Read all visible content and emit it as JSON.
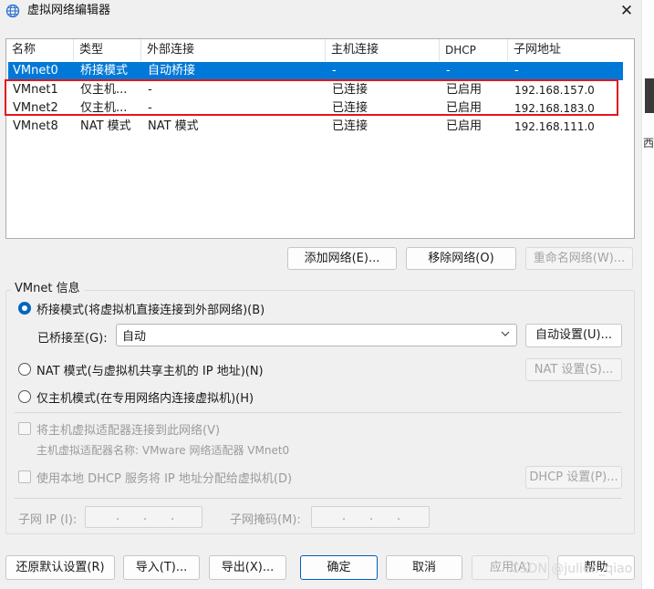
{
  "window": {
    "title": "虚拟网络编辑器",
    "close_glyph": "✕"
  },
  "table": {
    "columns": [
      "名称",
      "类型",
      "外部连接",
      "主机连接",
      "DHCP",
      "子网地址"
    ],
    "rows": [
      {
        "name": "VMnet0",
        "type": "桥接模式",
        "external": "自动桥接",
        "host": "-",
        "dhcp": "-",
        "subnet": "-",
        "selected": true
      },
      {
        "name": "VMnet1",
        "type": "仅主机...",
        "external": "-",
        "host": "已连接",
        "dhcp": "已启用",
        "subnet": "192.168.157.0",
        "selected": false
      },
      {
        "name": "VMnet2",
        "type": "仅主机...",
        "external": "-",
        "host": "已连接",
        "dhcp": "已启用",
        "subnet": "192.168.183.0",
        "selected": false
      },
      {
        "name": "VMnet8",
        "type": "NAT 模式",
        "external": "NAT 模式",
        "host": "已连接",
        "dhcp": "已启用",
        "subnet": "192.168.111.0",
        "selected": false
      }
    ]
  },
  "network_buttons": {
    "add": "添加网络(E)...",
    "remove": "移除网络(O)",
    "rename": "重命名网络(W)..."
  },
  "info": {
    "group_label": "VMnet 信息",
    "bridged_radio": "桥接模式(将虚拟机直接连接到外部网络)(B)",
    "bridged_to_label": "已桥接至(G):",
    "bridged_to_value": "自动",
    "auto_settings": "自动设置(U)...",
    "nat_radio": "NAT 模式(与虚拟机共享主机的 IP 地址)(N)",
    "nat_settings": "NAT 设置(S)...",
    "hostonly_radio": "仅主机模式(在专用网络内连接虚拟机)(H)",
    "connect_adapter": "将主机虚拟适配器连接到此网络(V)",
    "adapter_name": "主机虚拟适配器名称: VMware 网络适配器 VMnet0",
    "use_dhcp": "使用本地 DHCP 服务将 IP 地址分配给虚拟机(D)",
    "dhcp_settings": "DHCP 设置(P)...",
    "subnet_ip_label": "子网 IP (I):",
    "subnet_mask_label": "子网掩码(M):",
    "ip_dots": "."
  },
  "footer": {
    "restore": "还原默认设置(R)",
    "import": "导入(T)...",
    "export": "导出(X)...",
    "ok": "确定",
    "cancel": "取消",
    "apply": "应用(A)",
    "help": "帮助"
  },
  "watermark": "CSDN @julien_qiao",
  "side_fragment": "西",
  "colors": {
    "selection": "#0078d7",
    "highlight_box": "#e2151c",
    "radio_on": "#0067c0"
  }
}
